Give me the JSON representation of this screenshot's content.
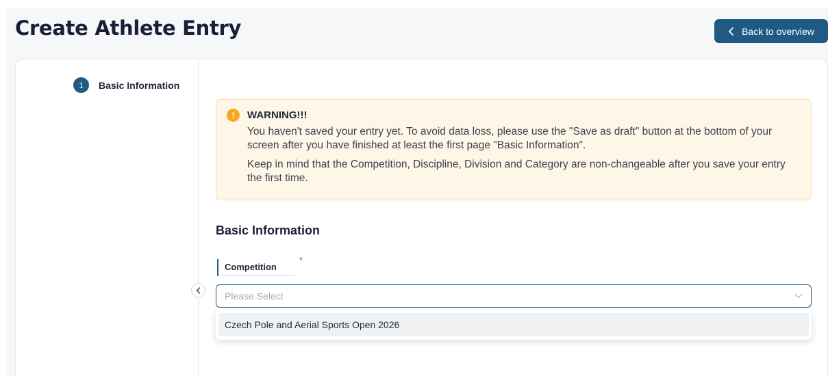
{
  "header": {
    "title": "Create Athlete Entry",
    "back_label": "Back to overview"
  },
  "sidebar": {
    "steps": [
      {
        "number": "1",
        "label": "Basic Information"
      }
    ]
  },
  "warning": {
    "title": "WARNING!!!",
    "paragraphs": [
      "You haven't saved your entry yet. To avoid data loss, please use the \"Save as draft\" button at the bottom of your screen after you have finished at least the first page \"Basic Information\".",
      "Keep in mind that the Competition, Discipline, Division and Category are non-changeable after you save your entry the first time."
    ]
  },
  "form": {
    "section_title": "Basic Information",
    "competition": {
      "label": "Competition",
      "required_mark": "*",
      "placeholder": "Please Select",
      "options": [
        "Czech Pole and Aerial Sports Open 2026"
      ]
    }
  },
  "colors": {
    "primary": "#1f5a85",
    "warning_bg": "#fef6e6",
    "warning_icon": "#f5a623",
    "required": "#d9363e"
  },
  "icons": {
    "back": "chevron-left-icon",
    "warning": "exclamation-circle-icon",
    "collapse": "chevron-left-icon",
    "select": "chevron-down-icon"
  }
}
